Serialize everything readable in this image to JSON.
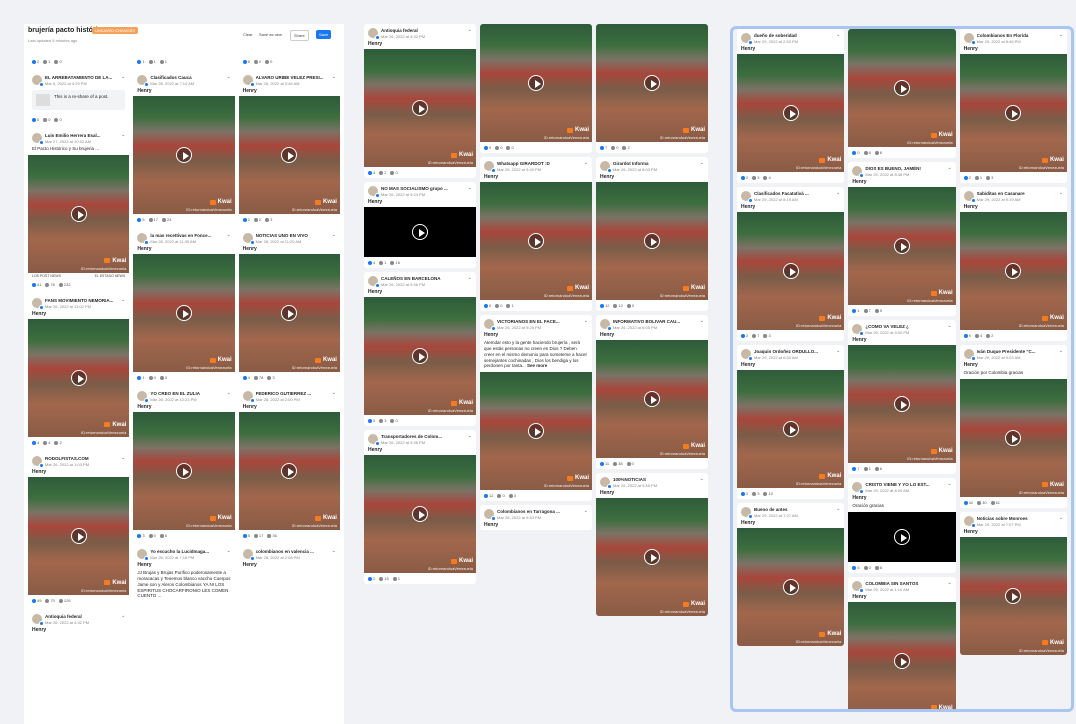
{
  "header": {
    "title": "brujería pacto histórico",
    "badge": "UNSAVED CHANGES",
    "updated": "Last updated 5 minutes ago",
    "buttons": [
      "Clear",
      "Save as new",
      "Share",
      "Save"
    ]
  },
  "brand": {
    "accent": "#1877f2",
    "badge_color": "#f4a15b",
    "kwai_color": "#f47b20"
  },
  "watermark": {
    "kwai": "Kwai",
    "id": "ID:retornandoaVenezuela"
  },
  "panel1": {
    "col1": [
      {
        "type": "stats",
        "stats": [
          "2",
          "1",
          "0"
        ]
      },
      {
        "name": "EL ARREBATAMIENTO DE LA...",
        "date": "Mar 6, 2022 at 4:29 PM",
        "share": "This is a re-share of a post.",
        "stats": [
          "0",
          "0",
          "0"
        ]
      },
      {
        "name": "Luis Emilio Herrera Esal...",
        "date": "Mar 27, 2022 at 10:02 AM",
        "body": "El Pacto Histórico y Su brujeria ...",
        "video": "tall",
        "caption_l": "LOS POST NEWS",
        "caption_r": "EL ESTADO NEWS",
        "stats": [
          "41",
          "76",
          "232"
        ]
      },
      {
        "name": "FANS MOVIMIENTO NEMORIA...",
        "date": "Mar 26, 2022 at 11:02 PM",
        "author": "Henry",
        "video": "kwai",
        "stats": [
          "4",
          "4",
          "2"
        ]
      },
      {
        "name": "RODOLFISTAS.COM",
        "date": "Mar 26, 2022 at 1:03 PM",
        "author": "Henry",
        "video": "kwai",
        "stats": [
          "49",
          "70",
          "126"
        ]
      },
      {
        "name": "Antioquia federal",
        "date": "Mar 26, 2022 at 4:32 PM",
        "author": "Henry"
      }
    ],
    "col2": [
      {
        "type": "stats",
        "stats": [
          "1",
          "1",
          "1"
        ]
      },
      {
        "name": "Clasificados Cauca",
        "date": "Mar 28, 2022 at 7:10 AM",
        "author": "Henry",
        "video": "kwai",
        "stats": [
          "5",
          "17",
          "24"
        ]
      },
      {
        "name": "la mas recettivas en Fonce...",
        "date": "Mar 28, 2022 at 11:30 AM",
        "author": "Henry",
        "video": "kwai",
        "stats": [
          "1",
          "0",
          "3"
        ]
      },
      {
        "name": "YO CREO EN EL ZULIA",
        "date": "Mar 28, 2022 at 10:23 PM",
        "author": "Henry",
        "video": "kwai",
        "stats": [
          "3",
          "0",
          "6"
        ]
      },
      {
        "name": "Yo escucho la Lucidmaga...",
        "date": "Mar 28, 2022 at 7:16 PM",
        "author": "Henry",
        "body": "JJ Brujas y Brujas Purifico poderosamente a moracacas y Tenemos blanco vaccho Cuerpos Jame son y Aleros Colombianos YA NI LOS ESPIRITUS CHOCARFIRONIO LES COMEN CUENTO ..."
      }
    ],
    "col3": [
      {
        "type": "stats",
        "stats": [
          "6",
          "0",
          "0"
        ]
      },
      {
        "name": "ALVARO URIBE VELEZ PRESI...",
        "date": "Mar 26, 2022 at 3:46 AM",
        "author": "Henry",
        "video": "kwai",
        "stats": [
          "2",
          "2",
          "3"
        ]
      },
      {
        "name": "NOTICIAS UNO EN VIVO",
        "date": "Mar 28, 2022 at 11:20 AM",
        "author": "Henry",
        "video": "kwai",
        "stats": [
          "4",
          "78",
          "3"
        ]
      },
      {
        "name": "FEDERICO GUTIERREZ ...",
        "date": "Mar 28, 2022 at 2:00 PM",
        "author": "Henry",
        "video": "kwai",
        "stats": [
          "5",
          "17",
          "36"
        ]
      },
      {
        "name": "colombianos en valencia ...",
        "date": "Mar 28, 2022 at 2:08 PM",
        "author": "Henry"
      }
    ]
  },
  "panel2": {
    "col1": [
      {
        "name": "Antioquia federal",
        "date": "Mar 26, 2022 at 4:32 PM",
        "author": "Henry",
        "video": "kwai",
        "stats": [
          "4",
          "2",
          "0"
        ]
      },
      {
        "name": "NO MAS SOCIALISMO grupo ...",
        "date": "Mar 26, 2022 at 9:24 PM",
        "author": "Henry",
        "video": "black",
        "stats": [
          "4",
          "1",
          "16"
        ]
      },
      {
        "name": "CALEÑOS EN BARCELONA",
        "date": "Mar 26, 2022 at 9:36 PM",
        "author": "Henry",
        "video": "kwai",
        "stats": [
          "0",
          "3",
          "0"
        ]
      },
      {
        "name": "Transportadores de Colom...",
        "date": "Mar 26, 2022 at 9:36 PM",
        "author": "Henry",
        "video": "kwai",
        "stats": [
          "2",
          "15",
          "1"
        ]
      }
    ],
    "col2": [
      {
        "type": "videoonly",
        "video": "kwai",
        "stats": [
          "0",
          "0",
          "0"
        ]
      },
      {
        "name": "Whatsapp GIRARDOT :D",
        "date": "Mar 26, 2022 at 9:40 PM",
        "author": "Henry",
        "video": "kwai",
        "stats": [
          "0",
          "0",
          "1"
        ]
      },
      {
        "name": "VICTORIANOS EN EL FACE...",
        "date": "Mar 26, 2022 at 9:25 PM",
        "author": "Henry",
        "body": "Atemdar esto y la gente haciendo brujería , será que estás personas no creen en Dios ? Deben creer en el mismo demonio para someterse a hacer semejantes cochinadas , Dios los bendiga y los perdonen por tanta...",
        "more": "See more",
        "video": "kwai",
        "stats": [
          "12",
          "0",
          "3"
        ]
      },
      {
        "name": "Colombianos en Tarragona ...",
        "date": "Mar 26, 2022 at 9:53 PM",
        "author": "Henry"
      }
    ],
    "col3": [
      {
        "type": "videoonly",
        "video": "kwai",
        "stats": [
          "7",
          "0",
          "2"
        ]
      },
      {
        "name": "Girardot Informa",
        "date": "Mar 26, 2022 at 8:03 PM",
        "author": "Henry",
        "video": "kwai",
        "stats": [
          "12",
          "12",
          "0"
        ]
      },
      {
        "name": "INFORMATIVO BOLIVAR CAU...",
        "date": "Mar 26, 2022 at 6:05 PM",
        "author": "Henry",
        "video": "kwai",
        "stats": [
          "11",
          "38",
          "0"
        ]
      },
      {
        "name": "100%NOTICIAS",
        "date": "Mar 26, 2022 at 5:55 PM",
        "author": "Henry",
        "video": "kwai"
      }
    ]
  },
  "panel3": {
    "col1": [
      {
        "name": "dueño de soberidad",
        "date": "Mar 29, 2022 at 2:53 PM",
        "author": "Henry",
        "video": "kwai",
        "stats": [
          "2",
          "3",
          "4"
        ]
      },
      {
        "name": "Clasificados Facatativá ...",
        "date": "Mar 29, 2022 at 8:19 AM",
        "author": "Henry",
        "video": "kwai",
        "stats": [
          "2",
          "7",
          "3"
        ]
      },
      {
        "name": "Joaquin Ordoñez ORDULLO...",
        "date": "Mar 29, 2022 at 6:53 AM",
        "author": "Henry",
        "video": "kwai",
        "stats": [
          "2",
          "3",
          "10"
        ]
      },
      {
        "name": "Bueno de antes",
        "date": "Mar 29, 2022 at 7:27 AM",
        "author": "Henry",
        "video": "kwai"
      }
    ],
    "col2": [
      {
        "type": "videoonly",
        "video": "kwai",
        "stats": [
          "0",
          "6",
          "6"
        ]
      },
      {
        "name": "DIOS ES BUENO, JAMÉN!",
        "date": "Mar 29, 2022 at 8:48 PM",
        "author": "Henry",
        "video": "kwai",
        "stats": [
          "1",
          "7",
          "5"
        ]
      },
      {
        "name": "¿COMO VA VELEZ ¿",
        "date": "Mar 29, 2022 at 9:00 PM",
        "author": "Henry",
        "video": "kwai",
        "stats": [
          "7",
          "1",
          "6"
        ]
      },
      {
        "name": "CRISTO VIENE Y YO LO EST...",
        "date": "Mar 29, 2022 at 8:20 AM",
        "author": "Henry",
        "body": "Oración gracias",
        "video": "black",
        "stats": [
          "5",
          "0",
          "8"
        ]
      },
      {
        "name": "COLOMBIA SIN SANTOS",
        "date": "Mar 29, 2022 at 1:10 AM",
        "author": "Henry",
        "video": "kwai"
      }
    ],
    "col3": [
      {
        "name": "Colombianos En Florida",
        "date": "Mar 29, 2022 at 8:46 PM",
        "author": "Henry",
        "video": "kwai",
        "stats": [
          "2",
          "1",
          "3"
        ]
      },
      {
        "name": "Sabiditas en Casanare",
        "date": "Mar 29, 2022 at 9:19 AM",
        "author": "Henry",
        "video": "kwai",
        "stats": [
          "9",
          "4",
          "2"
        ]
      },
      {
        "name": "Iván Duque Presidente \"C...",
        "date": "Mar 29, 2022 at 9:03 AM",
        "author": "Henry",
        "body": "Oración por Colombia gracias",
        "video": "kwai",
        "stats": [
          "42",
          "30",
          "61"
        ]
      },
      {
        "name": "Noticias sobre Monroes",
        "date": "Mar 29, 2022 at 7:07 PM",
        "author": "Henry",
        "video": "kwai"
      }
    ]
  }
}
